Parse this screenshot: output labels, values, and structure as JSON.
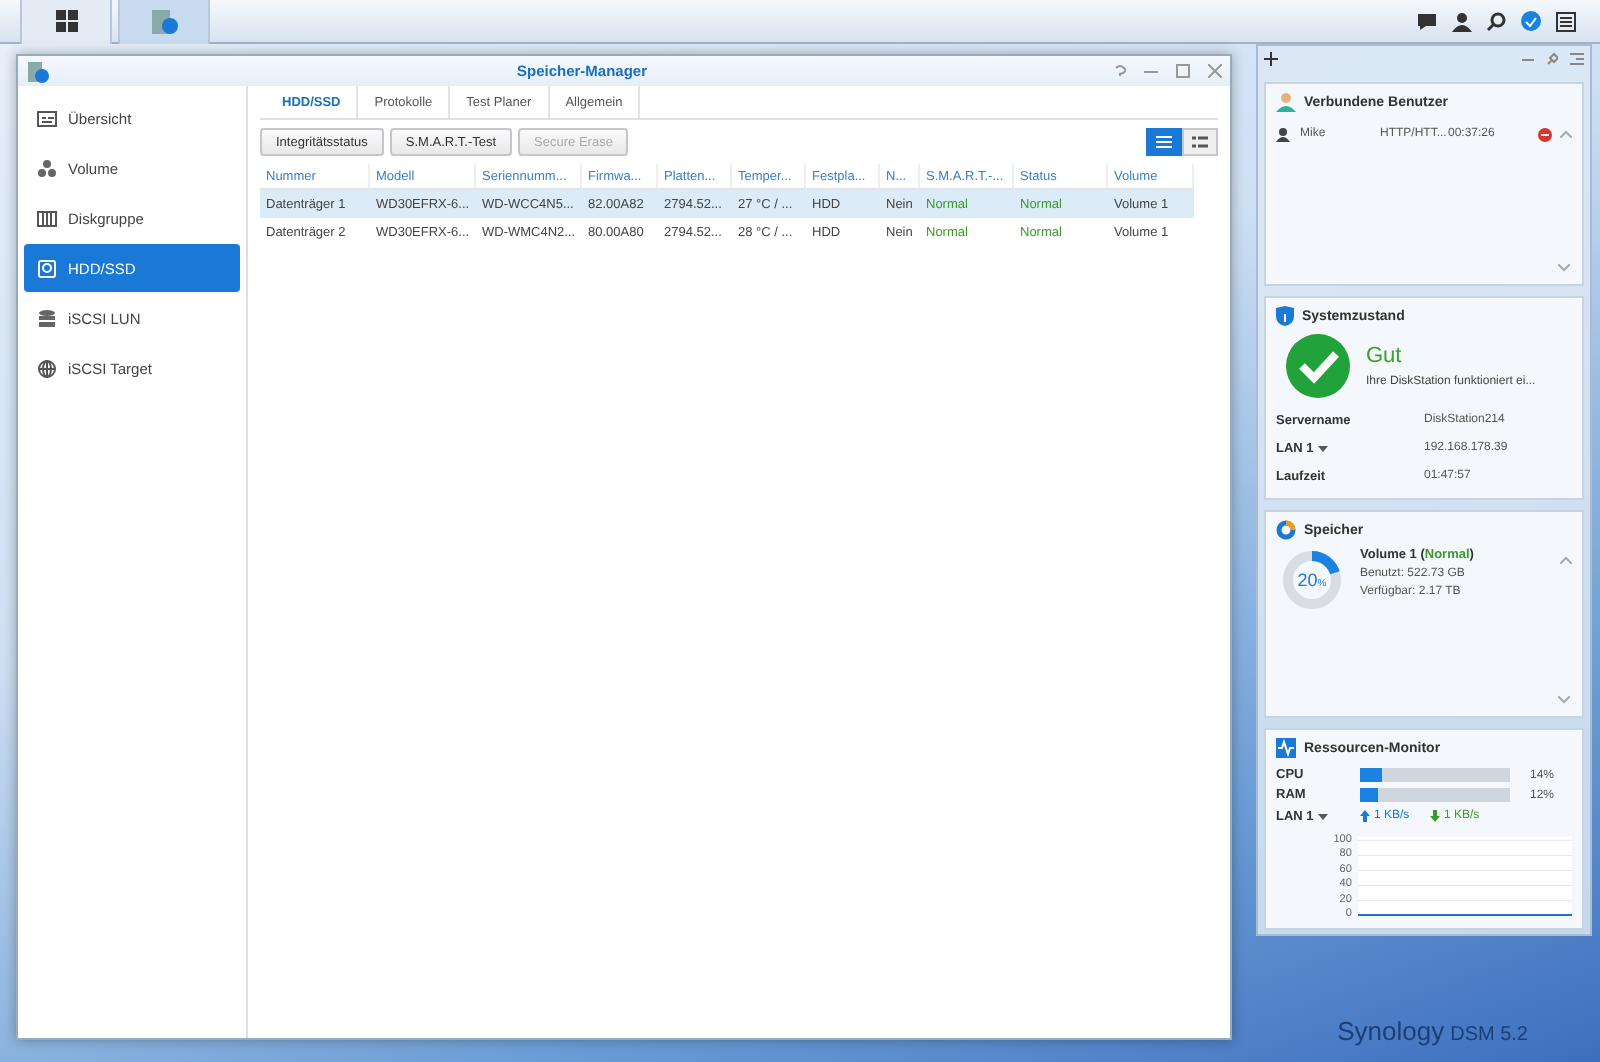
{
  "window": {
    "title": "Speicher-Manager"
  },
  "sidebar": {
    "items": [
      {
        "label": "Übersicht",
        "selected": false
      },
      {
        "label": "Volume",
        "selected": false
      },
      {
        "label": "Diskgruppe",
        "selected": false
      },
      {
        "label": "HDD/SSD",
        "selected": true
      },
      {
        "label": "iSCSI LUN",
        "selected": false
      },
      {
        "label": "iSCSI Target",
        "selected": false
      }
    ]
  },
  "tabs": [
    {
      "label": "HDD/SSD",
      "selected": true
    },
    {
      "label": "Protokolle",
      "selected": false
    },
    {
      "label": "Test Planer",
      "selected": false
    },
    {
      "label": "Allgemein",
      "selected": false
    }
  ],
  "toolbar": {
    "buttons": [
      {
        "label": "Integritätsstatus",
        "disabled": false
      },
      {
        "label": "S.M.A.R.T.-Test",
        "disabled": false
      },
      {
        "label": "Secure Erase",
        "disabled": true
      }
    ],
    "view_modes": [
      {
        "selected": true
      },
      {
        "selected": false
      }
    ]
  },
  "table": {
    "columns": [
      {
        "label": "Nummer",
        "kind": "text"
      },
      {
        "label": "Modell",
        "kind": "text"
      },
      {
        "label": "Seriennumm...",
        "kind": "text"
      },
      {
        "label": "Firmwa...",
        "kind": "text"
      },
      {
        "label": "Platten...",
        "kind": "text"
      },
      {
        "label": "Temper...",
        "kind": "text"
      },
      {
        "label": "Festpla...",
        "kind": "text"
      },
      {
        "label": "N...",
        "kind": "text"
      },
      {
        "label": "S.M.A.R.T.-...",
        "kind": "status"
      },
      {
        "label": "Status",
        "kind": "status"
      },
      {
        "label": "Volume",
        "kind": "text"
      }
    ],
    "rows": [
      {
        "selected": true,
        "cells": [
          "Datenträger 1",
          "WD30EFRX-6...",
          "WD-WCC4N5...",
          "82.00A82",
          "2794.52...",
          "27 °C / ...",
          "HDD",
          "Nein",
          "Normal",
          "Normal",
          "Volume 1"
        ]
      },
      {
        "selected": false,
        "cells": [
          "Datenträger 2",
          "WD30EFRX-6...",
          "WD-WMC4N2...",
          "80.00A80",
          "2794.52...",
          "28 °C / ...",
          "HDD",
          "Nein",
          "Normal",
          "Normal",
          "Volume 1"
        ]
      }
    ]
  },
  "widgets": {
    "users": {
      "title": "Verbundene Benutzer",
      "users": [
        {
          "name": "Mike",
          "protocol": "HTTP/HTT...",
          "time": "00:37:26"
        }
      ]
    },
    "system": {
      "title": "Systemzustand",
      "status": "Gut",
      "message": "Ihre DiskStation funktioniert ei...",
      "rows": [
        {
          "label": "Servername",
          "value": "DiskStation214",
          "menu": false
        },
        {
          "label": "LAN 1",
          "value": "192.168.178.39",
          "menu": true
        },
        {
          "label": "Laufzeit",
          "value": "01:47:57",
          "menu": false
        }
      ]
    },
    "storage": {
      "title": "Speicher",
      "volume": "Volume 1 (**Normal**)",
      "used": "Benutzt: 522.73 GB",
      "free": "Verfügbar: 2.17 TB",
      "percent": "20",
      "unit": "%",
      "level": 0.2
    },
    "resources": {
      "title": "Ressourcen-Monitor",
      "meters": [
        {
          "label": "CPU",
          "level": 0.14,
          "reading": "14%"
        },
        {
          "label": "RAM",
          "level": 0.12,
          "reading": "12%"
        }
      ],
      "lan": {
        "label": "LAN 1",
        "up": "1 KB/s",
        "down": "1 KB/s"
      },
      "chart_data": {
        "type": "line",
        "grid": true,
        "ylim": [
          0,
          100
        ],
        "yticks": [
          0,
          20,
          40,
          60,
          80,
          100
        ],
        "series": [
          {
            "color": "#1a73c8",
            "values": [
              1,
              1,
              1,
              1,
              1,
              1,
              1,
              1,
              1,
              1,
              1,
              1
            ]
          }
        ]
      }
    }
  },
  "brand": {
    "name": "Synology",
    "version": "DSM 5.2"
  }
}
